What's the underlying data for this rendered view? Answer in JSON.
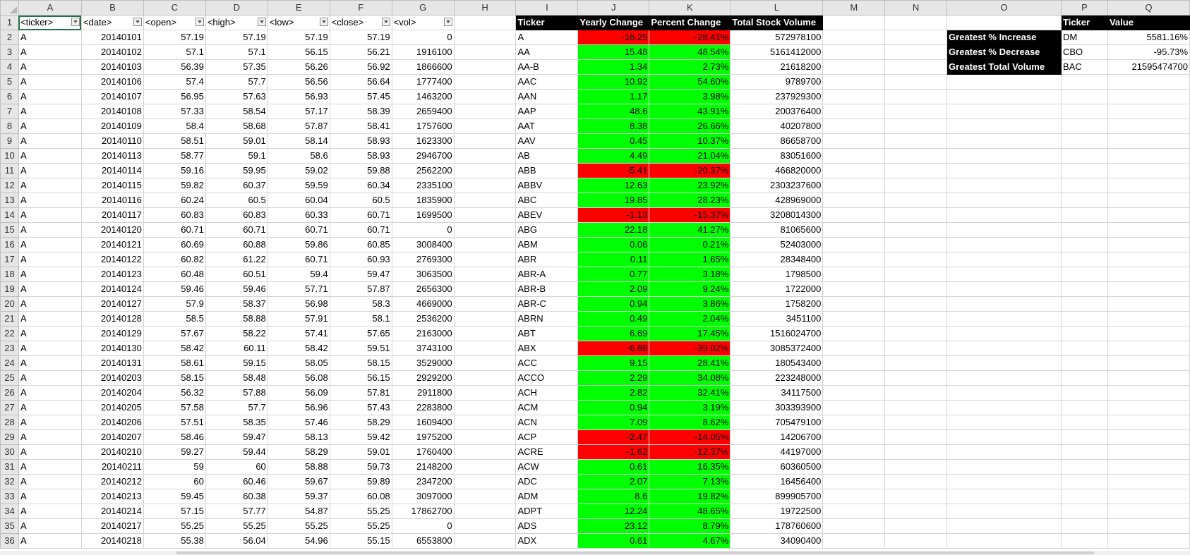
{
  "columns": [
    "A",
    "B",
    "C",
    "D",
    "E",
    "F",
    "G",
    "H",
    "I",
    "J",
    "K",
    "L",
    "M",
    "N",
    "O",
    "P",
    "Q"
  ],
  "header_row": {
    "raw": [
      "<ticker>",
      "<date>",
      "<open>",
      "<high>",
      "<low>",
      "<close>",
      "<vol>"
    ],
    "summary": [
      "Ticker",
      "Yearly Change",
      "Percent Change",
      "Total Stock Volume"
    ],
    "best": [
      "Ticker",
      "Value"
    ]
  },
  "raw_rows": [
    [
      "A",
      "20140101",
      "57.19",
      "57.19",
      "57.19",
      "57.19",
      "0"
    ],
    [
      "A",
      "20140102",
      "57.1",
      "57.1",
      "56.15",
      "56.21",
      "1916100"
    ],
    [
      "A",
      "20140103",
      "56.39",
      "57.35",
      "56.26",
      "56.92",
      "1866600"
    ],
    [
      "A",
      "20140106",
      "57.4",
      "57.7",
      "56.56",
      "56.64",
      "1777400"
    ],
    [
      "A",
      "20140107",
      "56.95",
      "57.63",
      "56.93",
      "57.45",
      "1463200"
    ],
    [
      "A",
      "20140108",
      "57.33",
      "58.54",
      "57.17",
      "58.39",
      "2659400"
    ],
    [
      "A",
      "20140109",
      "58.4",
      "58.68",
      "57.87",
      "58.41",
      "1757600"
    ],
    [
      "A",
      "20140110",
      "58.51",
      "59.01",
      "58.14",
      "58.93",
      "1623300"
    ],
    [
      "A",
      "20140113",
      "58.77",
      "59.1",
      "58.6",
      "58.93",
      "2946700"
    ],
    [
      "A",
      "20140114",
      "59.16",
      "59.95",
      "59.02",
      "59.88",
      "2562200"
    ],
    [
      "A",
      "20140115",
      "59.82",
      "60.37",
      "59.59",
      "60.34",
      "2335100"
    ],
    [
      "A",
      "20140116",
      "60.24",
      "60.5",
      "60.04",
      "60.5",
      "1835900"
    ],
    [
      "A",
      "20140117",
      "60.83",
      "60.83",
      "60.33",
      "60.71",
      "1699500"
    ],
    [
      "A",
      "20140120",
      "60.71",
      "60.71",
      "60.71",
      "60.71",
      "0"
    ],
    [
      "A",
      "20140121",
      "60.69",
      "60.88",
      "59.86",
      "60.85",
      "3008400"
    ],
    [
      "A",
      "20140122",
      "60.82",
      "61.22",
      "60.71",
      "60.93",
      "2769300"
    ],
    [
      "A",
      "20140123",
      "60.48",
      "60.51",
      "59.4",
      "59.47",
      "3063500"
    ],
    [
      "A",
      "20140124",
      "59.46",
      "59.46",
      "57.71",
      "57.87",
      "2656300"
    ],
    [
      "A",
      "20140127",
      "57.9",
      "58.37",
      "56.98",
      "58.3",
      "4669000"
    ],
    [
      "A",
      "20140128",
      "58.5",
      "58.88",
      "57.91",
      "58.1",
      "2536200"
    ],
    [
      "A",
      "20140129",
      "57.67",
      "58.22",
      "57.41",
      "57.65",
      "2163000"
    ],
    [
      "A",
      "20140130",
      "58.42",
      "60.11",
      "58.42",
      "59.51",
      "3743100"
    ],
    [
      "A",
      "20140131",
      "58.61",
      "59.15",
      "58.05",
      "58.15",
      "3529000"
    ],
    [
      "A",
      "20140203",
      "58.15",
      "58.48",
      "56.08",
      "56.15",
      "2929200"
    ],
    [
      "A",
      "20140204",
      "56.32",
      "57.88",
      "56.09",
      "57.81",
      "2911800"
    ],
    [
      "A",
      "20140205",
      "57.58",
      "57.7",
      "56.96",
      "57.43",
      "2283800"
    ],
    [
      "A",
      "20140206",
      "57.51",
      "58.35",
      "57.46",
      "58.29",
      "1609400"
    ],
    [
      "A",
      "20140207",
      "58.46",
      "59.47",
      "58.13",
      "59.42",
      "1975200"
    ],
    [
      "A",
      "20140210",
      "59.27",
      "59.44",
      "58.29",
      "59.01",
      "1760400"
    ],
    [
      "A",
      "20140211",
      "59",
      "60",
      "58.88",
      "59.73",
      "2148200"
    ],
    [
      "A",
      "20140212",
      "60",
      "60.46",
      "59.67",
      "59.89",
      "2347200"
    ],
    [
      "A",
      "20140213",
      "59.45",
      "60.38",
      "59.37",
      "60.08",
      "3097000"
    ],
    [
      "A",
      "20140214",
      "57.15",
      "57.77",
      "54.87",
      "55.25",
      "17862700"
    ],
    [
      "A",
      "20140217",
      "55.25",
      "55.25",
      "55.25",
      "55.25",
      "0"
    ],
    [
      "A",
      "20140218",
      "55.38",
      "56.04",
      "54.96",
      "55.15",
      "6553800"
    ]
  ],
  "summary_rows": [
    [
      "A",
      "-16.25",
      "-28.41%",
      "572978100"
    ],
    [
      "AA",
      "15.48",
      "48.54%",
      "5161412000"
    ],
    [
      "AA-B",
      "1.34",
      "2.73%",
      "21618200"
    ],
    [
      "AAC",
      "10.92",
      "54.60%",
      "9789700"
    ],
    [
      "AAN",
      "1.17",
      "3.98%",
      "237929300"
    ],
    [
      "AAP",
      "48.6",
      "43.91%",
      "200376400"
    ],
    [
      "AAT",
      "8.38",
      "26.66%",
      "40207800"
    ],
    [
      "AAV",
      "0.45",
      "10.37%",
      "86658700"
    ],
    [
      "AB",
      "4.49",
      "21.04%",
      "83051600"
    ],
    [
      "ABB",
      "-5.41",
      "-20.37%",
      "466820000"
    ],
    [
      "ABBV",
      "12.63",
      "23.92%",
      "2303237600"
    ],
    [
      "ABC",
      "19.85",
      "28.23%",
      "428969000"
    ],
    [
      "ABEV",
      "-1.13",
      "-15.37%",
      "3208014300"
    ],
    [
      "ABG",
      "22.18",
      "41.27%",
      "81065600"
    ],
    [
      "ABM",
      "0.06",
      "0.21%",
      "52403000"
    ],
    [
      "ABR",
      "0.11",
      "1.65%",
      "28348400"
    ],
    [
      "ABR-A",
      "0.77",
      "3.18%",
      "1798500"
    ],
    [
      "ABR-B",
      "2.09",
      "9.24%",
      "1722000"
    ],
    [
      "ABR-C",
      "0.94",
      "3.86%",
      "1758200"
    ],
    [
      "ABRN",
      "0.49",
      "2.04%",
      "3451100"
    ],
    [
      "ABT",
      "6.69",
      "17.45%",
      "1516024700"
    ],
    [
      "ABX",
      "-6.88",
      "-39.02%",
      "3085372400"
    ],
    [
      "ACC",
      "9.15",
      "28.41%",
      "180543400"
    ],
    [
      "ACCO",
      "2.29",
      "34.08%",
      "223248000"
    ],
    [
      "ACH",
      "2.82",
      "32.41%",
      "34117500"
    ],
    [
      "ACM",
      "0.94",
      "3.19%",
      "303393900"
    ],
    [
      "ACN",
      "7.09",
      "8.62%",
      "705479100"
    ],
    [
      "ACP",
      "-2.47",
      "-14.05%",
      "14206700"
    ],
    [
      "ACRE",
      "-1.62",
      "-12.37%",
      "44197000"
    ],
    [
      "ACW",
      "0.61",
      "16.35%",
      "60360500"
    ],
    [
      "ADC",
      "2.07",
      "7.13%",
      "16456400"
    ],
    [
      "ADM",
      "8.6",
      "19.82%",
      "899905700"
    ],
    [
      "ADPT",
      "12.24",
      "48.65%",
      "19722500"
    ],
    [
      "ADS",
      "23.12",
      "8.79%",
      "178760600"
    ],
    [
      "ADX",
      "0.61",
      "4.67%",
      "34090400"
    ]
  ],
  "greatest": [
    {
      "label": "Greatest % Increase",
      "ticker": "DM",
      "value": "5581.16%"
    },
    {
      "label": "Greatest % Decrease",
      "ticker": "CBO",
      "value": "-95.73%"
    },
    {
      "label": "Greatest Total Volume",
      "ticker": "BAC",
      "value": "21595474700"
    }
  ],
  "colors": {
    "positive": "#00ff00",
    "negative": "#ff0000",
    "header_fill": "#000000",
    "selection": "#217346"
  }
}
